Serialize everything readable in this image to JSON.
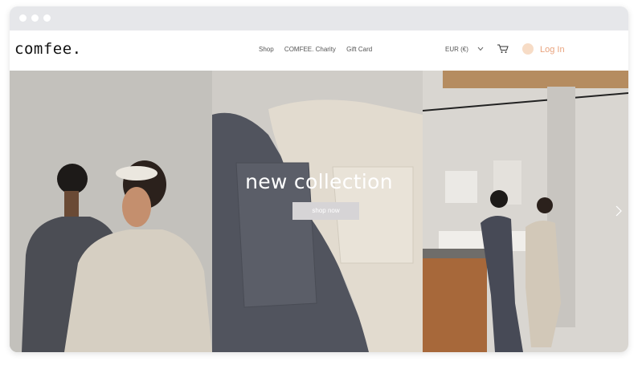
{
  "store": {
    "logo": "comfee."
  },
  "nav": {
    "items": [
      "Shop",
      "COMFEE. Charity",
      "Gift Card"
    ]
  },
  "currency": {
    "selected": "EUR (€)"
  },
  "account": {
    "login_label": "Log In"
  },
  "hero": {
    "headline": "new collection",
    "cta_label": "shop now"
  },
  "colors": {
    "login_accent": "#e9a37d",
    "cta_bg": "#d6d4d6"
  },
  "icons": [
    "chevron-down-icon",
    "cart-icon",
    "avatar-icon",
    "chevron-right-icon"
  ]
}
